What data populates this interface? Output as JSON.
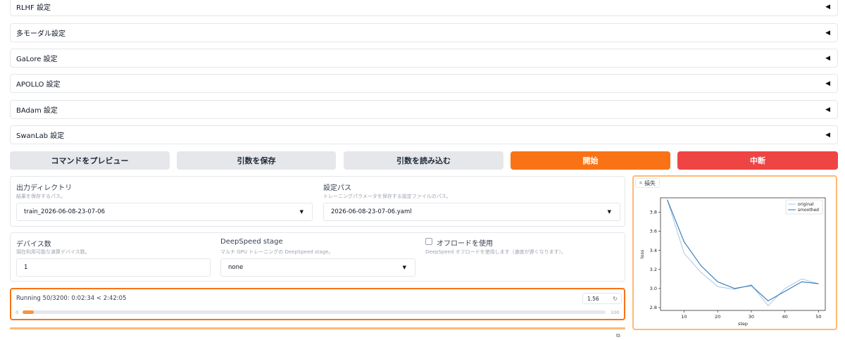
{
  "accordions": [
    {
      "label": "RLHF 設定"
    },
    {
      "label": "多モーダル設定"
    },
    {
      "label": "GaLore 設定"
    },
    {
      "label": "APOLLO 設定"
    },
    {
      "label": "BAdam 設定"
    },
    {
      "label": "SwanLab 設定"
    }
  ],
  "actions": {
    "preview": "コマンドをプレビュー",
    "save_args": "引数を保存",
    "load_args": "引数を読み込む",
    "start": "開始",
    "abort": "中断"
  },
  "output": {
    "dir_label": "出力ディレクトリ",
    "dir_hint": "結果を保存するパス。",
    "dir_value": "train_2026-06-08-23-07-06",
    "config_label": "設定パス",
    "config_hint": "トレーニングパラメータを保存する設定ファイルのパス。",
    "config_value": "2026-06-08-23-07-06.yaml"
  },
  "devices": {
    "count_label": "デバイス数",
    "count_hint": "現在利用可能な演算デバイス数。",
    "count_value": "1",
    "ds_label": "DeepSpeed stage",
    "ds_hint": "マルチ GPU トレーニングの DeepSpeed stage。",
    "ds_value": "none",
    "offload_label": "オフロードを使用",
    "offload_hint": "DeepSpeed オフロードを使用します（速度が遅くなります）。",
    "offload_checked": false
  },
  "progress": {
    "status": "Running 50/3200: 0:02:34 < 2:42:05",
    "value": "1.56",
    "min": "0",
    "max": "100",
    "fraction": 0.0156
  },
  "chart_panel": {
    "tab_label": "損失"
  },
  "chart_data": {
    "type": "line",
    "xlabel": "step",
    "ylabel": "loss",
    "xlim": [
      3,
      52
    ],
    "ylim": [
      2.77,
      3.95
    ],
    "xticks": [
      10,
      20,
      30,
      40,
      50
    ],
    "yticks": [
      2.8,
      3.0,
      3.2,
      3.4,
      3.6,
      3.8
    ],
    "legend_position": "top-right",
    "series": [
      {
        "name": "original",
        "color": "#a8c8e8",
        "x": [
          5,
          10,
          15,
          20,
          25,
          30,
          35,
          40,
          45,
          50
        ],
        "y": [
          3.93,
          3.37,
          3.17,
          3.02,
          2.99,
          3.04,
          2.82,
          3.0,
          3.1,
          3.05
        ]
      },
      {
        "name": "smoothed",
        "color": "#2f77b4",
        "x": [
          5,
          10,
          15,
          20,
          25,
          30,
          35,
          40,
          45,
          50
        ],
        "y": [
          3.93,
          3.49,
          3.24,
          3.07,
          3.0,
          3.03,
          2.87,
          2.97,
          3.07,
          3.05
        ]
      }
    ]
  }
}
